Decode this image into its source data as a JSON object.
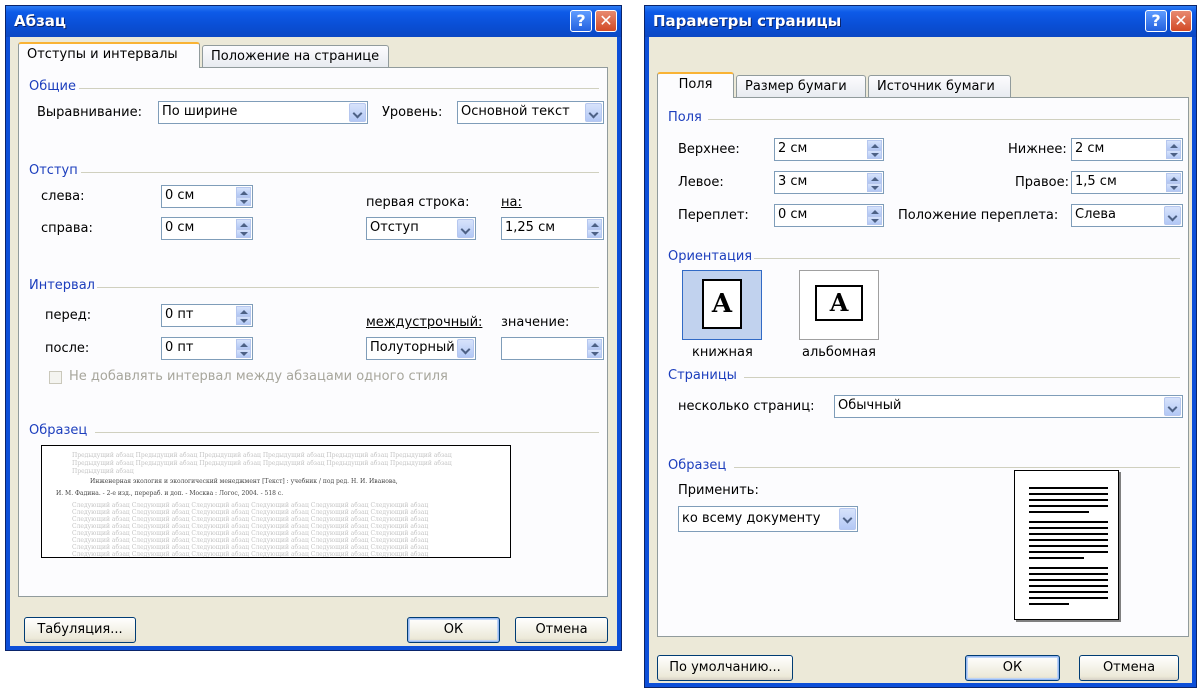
{
  "dlg1": {
    "title": "Абзац",
    "tabs": [
      "Отступы и интервалы",
      "Положение на странице"
    ],
    "general": {
      "title": "Общие",
      "align_label": "Выравнивание:",
      "align_value": "По ширине",
      "level_label": "Уровень:",
      "level_value": "Основной текст"
    },
    "indent": {
      "title": "Отступ",
      "left_label": "слева:",
      "left_value": "0 см",
      "right_label": "справа:",
      "right_value": "0 см",
      "first_label": "первая строка:",
      "first_value": "Отступ",
      "on_label": "на:",
      "on_value": "1,25 см"
    },
    "spacing": {
      "title": "Интервал",
      "before_label": "перед:",
      "before_value": "0 пт",
      "after_label": "после:",
      "after_value": "0 пт",
      "line_label": "междустрочный:",
      "line_value": "Полуторный",
      "value_label": "значение:",
      "value_value": "",
      "nospace_label": "Не добавлять интервал между абзацами одного стиля"
    },
    "sample": {
      "title": "Образец",
      "lines": [
        "Предыдущий абзац Предыдущий абзац Предыдущий абзац Предыдущий абзац Предыдущий абзац Предыдущий абзац",
        "Предыдущий абзац Предыдущий абзац Предыдущий абзац Предыдущий абзац Предыдущий абзац Предыдущий абзац",
        "Предыдущий абзац",
        "Инженерная экология и экологический менеджмент [Текст] : учебник / под ред. Н. И. Иванова,",
        "И. М. Фадина. - 2-е изд., перераб. и доп. - Москва : Логос, 2004. - 518 с.",
        "Следующий абзац Следующий абзац Следующий абзац Следующий абзац Следующий абзац Следующий абзац",
        "Следующий абзац Следующий абзац Следующий абзац Следующий абзац Следующий абзац Следующий абзац",
        "Следующий абзац Следующий абзац Следующий абзац Следующий абзац Следующий абзац Следующий абзац",
        "Следующий абзац Следующий абзац Следующий абзац Следующий абзац Следующий абзац Следующий абзац",
        "Следующий абзац Следующий абзац Следующий абзац Следующий абзац Следующий абзац Следующий абзац",
        "Следующий абзац Следующий абзац Следующий абзац Следующий абзац Следующий абзац Следующий абзац",
        "Следующий абзац Следующий абзац Следующий абзац Следующий абзац Следующий абзац Следующий абзац",
        "Следующий абзац Следующий абзац Следующий абзац Следующий абзац Следующий абзац Следующий абзац",
        "Следующий абзац Следующий абзац Следующий абзац Следующий абзац Следующий абзац Следующий абзац"
      ]
    },
    "buttons": {
      "tabs": "Табуляция...",
      "ok": "ОК",
      "cancel": "Отмена"
    }
  },
  "dlg2": {
    "title": "Параметры страницы",
    "tabs": [
      "Поля",
      "Размер бумаги",
      "Источник бумаги"
    ],
    "margins": {
      "title": "Поля",
      "top_label": "Верхнее:",
      "top_value": "2 см",
      "bottom_label": "Нижнее:",
      "bottom_value": "2 см",
      "left_label": "Левое:",
      "left_value": "3 см",
      "right_label": "Правое:",
      "right_value": "1,5 см",
      "gutter_label": "Переплет:",
      "gutter_value": "0 см",
      "gutter_pos_label": "Положение переплета:",
      "gutter_pos_value": "Слева"
    },
    "orientation": {
      "title": "Ориентация",
      "portrait": "книжная",
      "landscape": "альбомная",
      "glyph": "A"
    },
    "pages": {
      "title": "Страницы",
      "multi_label": "несколько страниц:",
      "multi_value": "Обычный"
    },
    "sample": {
      "title": "Образец",
      "apply_label": "Применить:",
      "apply_value": "ко всему документу"
    },
    "buttons": {
      "default": "По умолчанию...",
      "ok": "ОК",
      "cancel": "Отмена"
    }
  },
  "colors": {
    "title_bar": "#0a4fd6",
    "group_title": "#1c3ebd",
    "dialog_bg": "#ece9d8",
    "tab_accent": "#f9b335"
  },
  "icons": [
    "help-icon",
    "close-icon",
    "chevron-down-icon",
    "spin-up-icon",
    "spin-down-icon",
    "portrait-page-icon",
    "landscape-page-icon",
    "checkbox-icon"
  ]
}
